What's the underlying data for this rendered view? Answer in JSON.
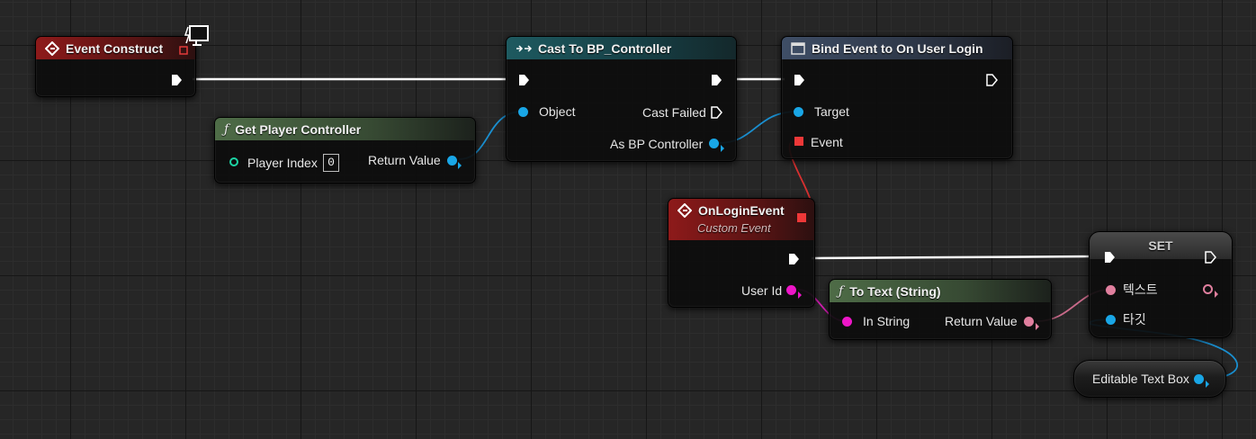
{
  "nodes": {
    "event_construct": {
      "title": "Event Construct"
    },
    "get_player_controller": {
      "title": "Get Player Controller",
      "player_index_label": "Player Index",
      "player_index_value": "0",
      "return_label": "Return Value"
    },
    "cast": {
      "title": "Cast To BP_Controller",
      "object_label": "Object",
      "cast_failed_label": "Cast Failed",
      "as_label": "As BP Controller"
    },
    "bind_event": {
      "title": "Bind Event to On User Login",
      "target_label": "Target",
      "event_label": "Event"
    },
    "on_login": {
      "title": "OnLoginEvent",
      "subtitle": "Custom Event",
      "user_id_label": "User Id"
    },
    "to_text": {
      "title": "To Text (String)",
      "in_label": "In String",
      "return_label": "Return Value"
    },
    "set": {
      "title": "SET",
      "text_label": "텍스트",
      "target_label": "타깃"
    },
    "editable_text_box": {
      "title": "Editable Text Box"
    }
  },
  "colors": {
    "exec": "#ffffff",
    "object_pin": "#19a6e6",
    "string_pin": "#ee16c8",
    "text_pin": "#e07f9e",
    "delegate_pin": "#ee3838",
    "int_pin": "#1cd4a4",
    "event_header": "#8e1a1a",
    "cast_header": "#1e5a60",
    "bind_header": "#3f4e66",
    "function_header": "#4e6c47"
  },
  "icons": {
    "event": "diamond-event-icon",
    "cast": "cast-arrow-icon",
    "bind": "window-icon",
    "function": "function-f-icon",
    "replication": "monitor-icon"
  }
}
